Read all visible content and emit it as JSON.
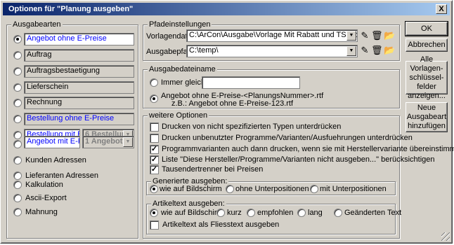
{
  "window": {
    "title": "Optionen für \"Planung ausgeben\"",
    "close": "X"
  },
  "ausgabearten": {
    "label": "Ausgabearten",
    "items": [
      {
        "label": "Angebot ohne E-Preise"
      },
      {
        "label": "Auftrag"
      },
      {
        "label": "Auftragsbestaetigung"
      },
      {
        "label": "Lieferschein"
      },
      {
        "label": "Rechnung"
      },
      {
        "label": "Bestellung ohne E-Preise"
      },
      {
        "label": "Bestellung mit E-Preise",
        "combo": "6 Bestellung"
      },
      {
        "label": "Angebot mit E-Preise",
        "combo": "1 Angebot"
      }
    ],
    "radios": [
      "Kunden Adressen",
      "Lieferanten Adressen",
      "Kalkulation",
      "Ascii-Export",
      "Mahnung"
    ]
  },
  "pfad": {
    "label": "Pfadeinstellungen",
    "vorlage_label": "Vorlagendatei",
    "vorlage_value": "C:\\ArCon\\Ausgabe\\Vorlage Mit Rabatt und TS incl MwSt.rtf",
    "ausgabe_label": "Ausgabepfad",
    "ausgabe_value": "C:\\temp\\"
  },
  "dateiname": {
    "label": "Ausgabedateiname",
    "immer_gleich": "Immer gleich",
    "auto_line1": "Angebot ohne E-Preise-<PlanungsNummer>.rtf",
    "auto_line2": "z.B.: Angebot ohne E-Preise-123.rtf"
  },
  "weitere": {
    "label": "weitere Optionen",
    "checks": [
      {
        "label": "Drucken von nicht spezifizierten Typen unterdrücken",
        "checked": false
      },
      {
        "label": "Drucken unbenutzter Programme/Varianten/Ausfuehrungen unterdrücken",
        "checked": false
      },
      {
        "label": "Programmvarianten auch dann drucken, wenn sie mit Herstellervariante übereinstimmen",
        "checked": true
      },
      {
        "label": "Liste \"Diese Hersteller/Programme/Varianten nicht ausgeben...\" berücksichtigen",
        "checked": true
      },
      {
        "label": "Tausendertrenner bei Preisen",
        "checked": true
      }
    ]
  },
  "generiert": {
    "label": "Generierte ausgeben:",
    "options": [
      "wie auf Bildschirm",
      "ohne Unterpositionen",
      "mit Unterpositionen"
    ]
  },
  "artikeltext": {
    "label": "Artikeltext ausgeben:",
    "options": [
      "wie auf Bildschirm",
      "kurz",
      "empfohlen",
      "lang",
      "Geänderten Text"
    ],
    "check": "Artikeltext als Fliesstext ausgeben"
  },
  "buttons": {
    "ok": "OK",
    "abbrechen": "Abbrechen",
    "vorlagen": "Alle Vorlagen-\nschlüssel-\nfelder\nanzeigen...",
    "neue": "Neue\nAusgabeart\nhinzufügen"
  },
  "check_mark": "✓"
}
